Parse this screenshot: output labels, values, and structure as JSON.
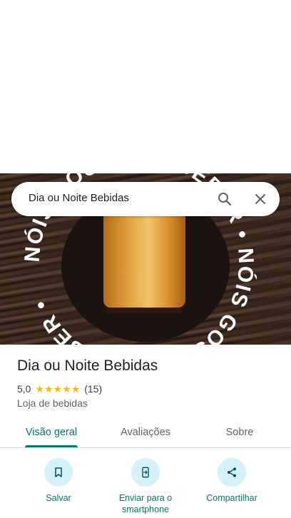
{
  "search": {
    "query": "Dia ou Noite Bebidas"
  },
  "hero": {
    "ring_text": "NÓIS GOSTA DE BEBER • NÓIS GOSTA DE BEBER •"
  },
  "place": {
    "name": "Dia ou Noite Bebidas",
    "rating": "5,0",
    "stars": "★★★★★",
    "review_count": "(15)",
    "category": "Loja de bebidas"
  },
  "tabs": [
    {
      "label": "Visão geral",
      "active": true
    },
    {
      "label": "Avaliações",
      "active": false
    },
    {
      "label": "Sobre",
      "active": false
    }
  ],
  "actions": [
    {
      "label": "Salvar",
      "icon": "bookmark-icon"
    },
    {
      "label": "Enviar para o smartphone",
      "icon": "send-to-phone-icon"
    },
    {
      "label": "Compartilhar",
      "icon": "share-icon"
    }
  ],
  "colors": {
    "accent": "#00796b",
    "action_circle": "#d4f1f9",
    "star": "#fbbc04"
  }
}
